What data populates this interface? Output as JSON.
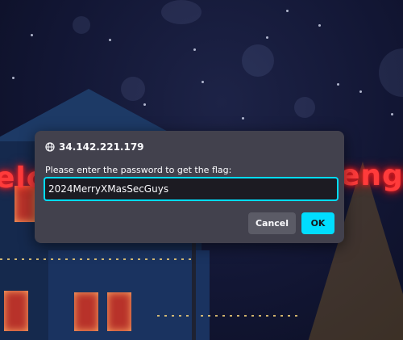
{
  "background": {
    "neon_left": "elc",
    "neon_right": "enge",
    "accent_color": "#ff3b3b"
  },
  "dialog": {
    "icon": "globe-icon",
    "host": "34.142.221.179",
    "message": "Please enter the password to get the flag:",
    "input_value": "2024MerryXMasSecGuys",
    "cancel_label": "Cancel",
    "ok_label": "OK",
    "focus_color": "#00ddff",
    "dialog_color": "#42414d"
  }
}
